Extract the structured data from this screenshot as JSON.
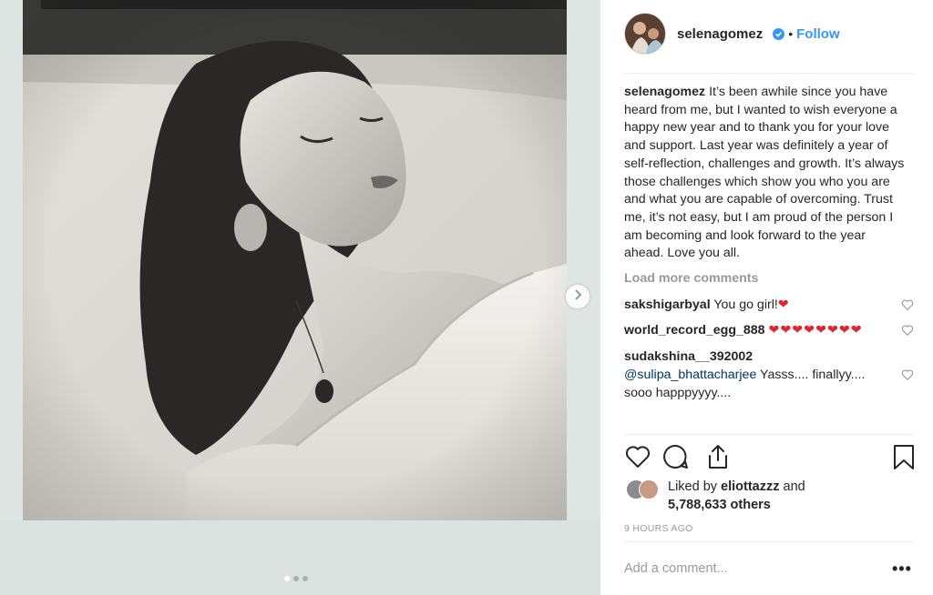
{
  "header": {
    "username": "selenagomez",
    "bullet": "•",
    "follow_label": "Follow"
  },
  "caption": {
    "username": "selenagomez",
    "text": "It’s been awhile since you have heard from me, but I wanted to wish everyone a happy new year and to thank you for your love and support. Last year was definitely a year of self-reflection, challenges and growth. It’s always those challenges which show you who you are and what you are capable of overcoming. Trust me, it’s not easy, but I am proud of the person I am becoming and look forward to the year ahead. Love you all."
  },
  "load_more_label": "Load more comments",
  "comments": [
    {
      "username": "sakshigarbyal",
      "text": "You go girl!",
      "hearts": "❤"
    },
    {
      "username": "world_record_egg_888",
      "text": "",
      "hearts": "❤❤❤❤❤❤❤❤"
    },
    {
      "username": "sudakshina__392002",
      "mention": "@sulipa_bhattacharjee",
      "text": "Yasss.... finallyy.... sooo happpyyyy...."
    }
  ],
  "likes": {
    "prefix": "Liked by",
    "liker": "eliottazzz",
    "and": "and",
    "others": "5,788,633 others"
  },
  "timestamp": "9 HOURS AGO",
  "add_comment_placeholder": "Add a comment...",
  "more_label": "•••",
  "carousel": {
    "slide_count": 3,
    "active_index": 0
  },
  "icons": [
    "chevron-right-icon",
    "heart-icon",
    "comment-icon",
    "share-icon",
    "bookmark-icon",
    "verified-badge-icon"
  ],
  "colors": {
    "link": "#3897f0",
    "mention": "#003569",
    "muted": "#999999",
    "heart": "#e0262f"
  }
}
